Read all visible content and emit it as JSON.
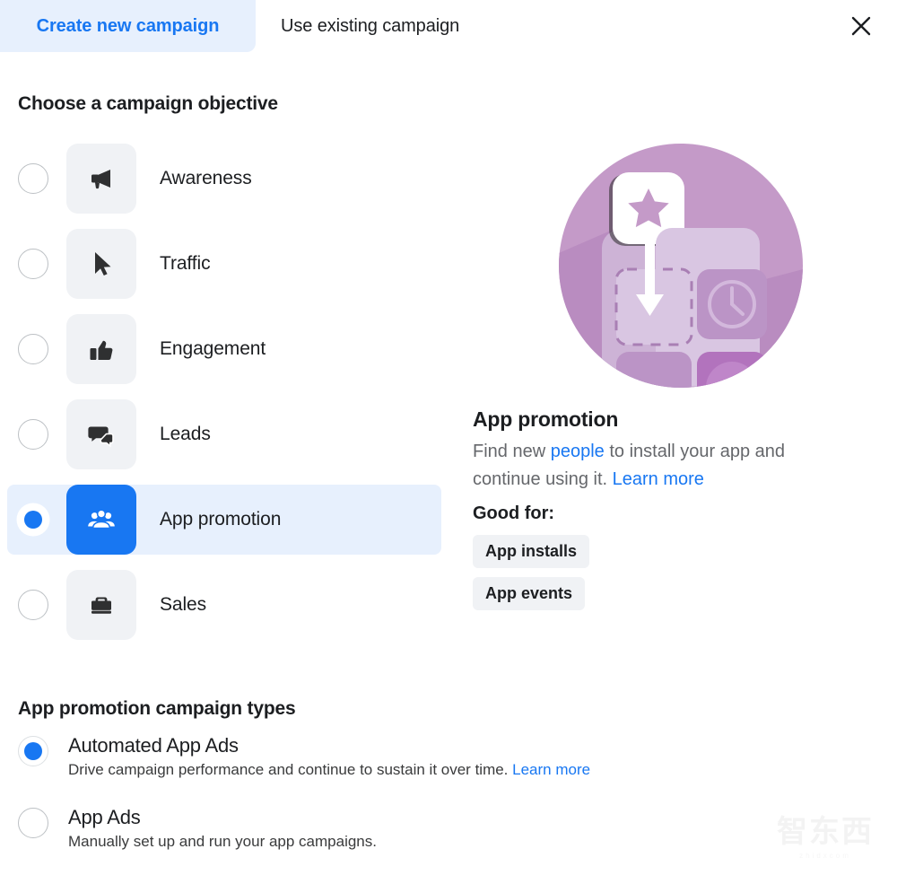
{
  "tabs": [
    {
      "label": "Create new campaign",
      "active": true
    },
    {
      "label": "Use existing campaign",
      "active": false
    }
  ],
  "close_icon": "close-icon",
  "objective_section": {
    "title": "Choose a campaign objective",
    "items": [
      {
        "label": "Awareness",
        "icon": "megaphone-icon",
        "selected": false
      },
      {
        "label": "Traffic",
        "icon": "cursor-icon",
        "selected": false
      },
      {
        "label": "Engagement",
        "icon": "thumbs-up-icon",
        "selected": false
      },
      {
        "label": "Leads",
        "icon": "chat-bubbles-icon",
        "selected": false
      },
      {
        "label": "App promotion",
        "icon": "people-group-icon",
        "selected": true
      },
      {
        "label": "Sales",
        "icon": "briefcase-icon",
        "selected": false
      }
    ]
  },
  "detail": {
    "illustration": "app-promotion-illustration",
    "title": "App promotion",
    "desc_part1": "Find new ",
    "desc_link1": "people",
    "desc_part2": " to install your app and continue using it. ",
    "desc_link2": "Learn more",
    "good_for_label": "Good for:",
    "badges": [
      "App installs",
      "App events"
    ]
  },
  "campaign_types": {
    "title": "App promotion campaign types",
    "items": [
      {
        "name": "Automated App Ads",
        "desc": "Drive campaign performance and continue to sustain it over time. ",
        "link": "Learn more",
        "selected": true
      },
      {
        "name": "App Ads",
        "desc": "Manually set up and run your app campaigns.",
        "link": "",
        "selected": false
      }
    ]
  },
  "watermark": {
    "text": "智东西",
    "sub": "zhidxcom"
  },
  "colors": {
    "accent_blue": "#1877f2",
    "selected_row_bg": "#e7f0fd",
    "tile_bg": "#f0f2f5",
    "text_primary": "#1c1e21",
    "text_secondary": "#65676b",
    "illustration_circle": "#c49ac8"
  }
}
